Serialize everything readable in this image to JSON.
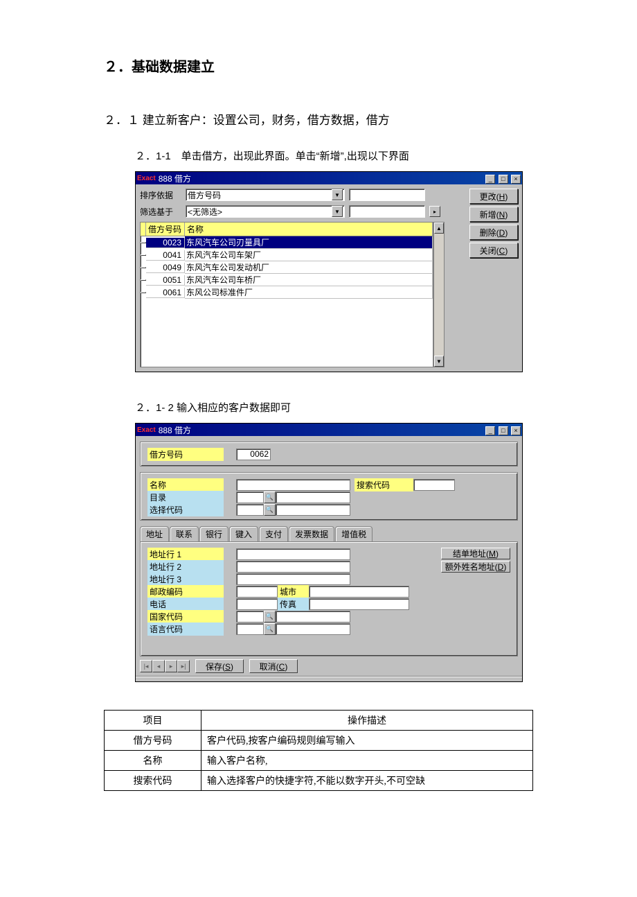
{
  "headings": {
    "h1": "２．基础数据建立",
    "h2": "２．１ 建立新客户：设置公司，财务，借方数据，借方",
    "h3a": "２．1-1　单击借方，出现此界面。单击“新增”,出现以下界面",
    "h3b": "２．1- 2 输入相应的客户数据即可"
  },
  "win1": {
    "brand": "Exact",
    "title": "888 借方",
    "sort_label": "排序依据",
    "sort_value": "借方号码",
    "filter_label": "筛选基于",
    "filter_value": "<无筛选>",
    "cols": {
      "code": "借方号码",
      "name": "名称"
    },
    "rows": [
      {
        "code": "0023",
        "name": "东风汽车公司刃量具厂"
      },
      {
        "code": "0041",
        "name": "东风汽车公司车架厂"
      },
      {
        "code": "0049",
        "name": "东风汽车公司发动机厂"
      },
      {
        "code": "0051",
        "name": "东风汽车公司车桥厂"
      },
      {
        "code": "0061",
        "name": "东风公司标准件厂"
      }
    ],
    "buttons": {
      "edit": "更改(H)",
      "new": "新增(N)",
      "del": "删除(D)",
      "close": "关闭(C)"
    }
  },
  "win2": {
    "brand": "Exact",
    "title": "888 借方",
    "top": {
      "code_label": "借方号码",
      "code_value": "0062",
      "name_label": "名称",
      "search_label": "搜索代码",
      "dir_label": "目录",
      "sel_label": "选择代码"
    },
    "tabs": [
      "地址",
      "联系",
      "银行",
      "键入",
      "支付",
      "发票数据",
      "增值税"
    ],
    "addr": {
      "line1": "地址行 1",
      "line2": "地址行 2",
      "line3": "地址行 3",
      "postal": "邮政编码",
      "city": "城市",
      "phone": "电话",
      "fax": "传真",
      "country": "国家代码",
      "lang": "语言代码",
      "bill_addr": "结单地址(M)",
      "extra_addr": "额外姓名地址(D)"
    },
    "nav": {
      "save": "保存(S)",
      "cancel": "取消(C)"
    }
  },
  "desc": {
    "head": {
      "item": "项目",
      "op": "操作描述"
    },
    "rows": [
      {
        "k": "借方号码",
        "v": "客户代码,按客户编码规则编写输入"
      },
      {
        "k": "名称",
        "v": "输入客户名称,"
      },
      {
        "k": "搜索代码",
        "v": "输入选择客户的快捷字符,不能以数字开头,不可空缺"
      }
    ]
  }
}
